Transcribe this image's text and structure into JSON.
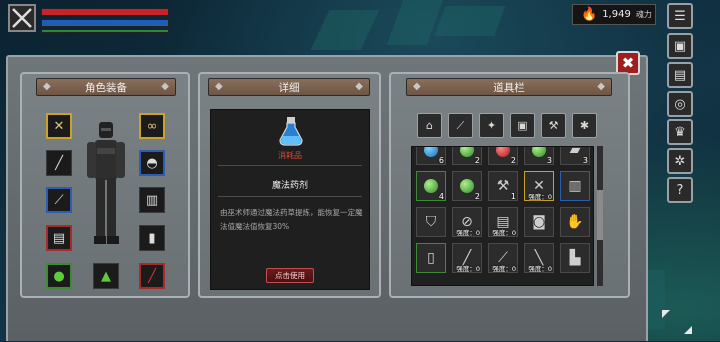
{
  "hud": {
    "soul_value": "1,949",
    "soul_unit": "魂力"
  },
  "side_menu": [
    {
      "name": "menu-button",
      "icon": "☰"
    },
    {
      "name": "equipment-button",
      "icon": "▣"
    },
    {
      "name": "inventory-bag-button",
      "icon": "▤"
    },
    {
      "name": "skills-button",
      "icon": "◎"
    },
    {
      "name": "crown-button",
      "icon": "♛"
    },
    {
      "name": "settings-button",
      "icon": "✲"
    },
    {
      "name": "help-button",
      "icon": "?"
    }
  ],
  "panels": {
    "equip_title": "角色装备",
    "detail_title": "详细",
    "inventory_title": "道具栏"
  },
  "equipment_slots": [
    {
      "name": "slot-weapon-main",
      "icon": "✕",
      "quality": "gold"
    },
    {
      "name": "slot-amulet",
      "icon": "∞",
      "quality": "gold"
    },
    {
      "name": "slot-spear",
      "icon": "╱",
      "quality": ""
    },
    {
      "name": "slot-helmet",
      "icon": "◓",
      "quality": "blue"
    },
    {
      "name": "slot-dagger",
      "icon": "⟋",
      "quality": "blue"
    },
    {
      "name": "slot-armor",
      "icon": "▥",
      "quality": ""
    },
    {
      "name": "slot-gloves",
      "icon": "▤",
      "quality": "red"
    },
    {
      "name": "slot-boots",
      "icon": "▮",
      "quality": ""
    },
    {
      "name": "slot-potion-green",
      "icon": "●",
      "quality": "green"
    },
    {
      "name": "slot-flask-green",
      "icon": "▲",
      "quality": ""
    },
    {
      "name": "slot-vial-red",
      "icon": "╱",
      "quality": "red"
    }
  ],
  "detail": {
    "item_type": "消耗品",
    "item_name": "魔法药剂",
    "item_desc": "由巫术师通过魔法药草提炼，能恢复一定魔法值魔法值恢复30%",
    "use_label": "点击使用"
  },
  "inventory_filters": [
    {
      "name": "filter-all",
      "icon": "⌂"
    },
    {
      "name": "filter-weapon",
      "icon": "⟋"
    },
    {
      "name": "filter-armor",
      "icon": "✦"
    },
    {
      "name": "filter-accessory",
      "icon": "▣"
    },
    {
      "name": "filter-tools",
      "icon": "⚒"
    },
    {
      "name": "filter-misc",
      "icon": "✱"
    }
  ],
  "inventory_items": [
    {
      "name": "item-mana-potion",
      "kind": "p-blue",
      "count": "6",
      "quality": ""
    },
    {
      "name": "item-green-flask",
      "kind": "p-green",
      "count": "2",
      "quality": ""
    },
    {
      "name": "item-red-potion",
      "kind": "p-red",
      "count": "2",
      "quality": ""
    },
    {
      "name": "item-green-potion",
      "kind": "p-green",
      "count": "3",
      "quality": ""
    },
    {
      "name": "item-iron-ingot",
      "kind": "icon",
      "icon": "▰",
      "count": "3",
      "quality": ""
    },
    {
      "name": "item-green-potion-2",
      "kind": "p-green",
      "count": "4",
      "quality": "green"
    },
    {
      "name": "item-green-potion-3",
      "kind": "p-green",
      "count": "2",
      "quality": ""
    },
    {
      "name": "item-axe",
      "kind": "icon",
      "icon": "⚒",
      "count": "1",
      "quality": ""
    },
    {
      "name": "item-crossed-swords",
      "kind": "icon",
      "icon": "✕",
      "count": "",
      "durability": "强度：0",
      "quality": "gold"
    },
    {
      "name": "item-chestplate",
      "kind": "icon",
      "icon": "▥",
      "count": "",
      "quality": "blue"
    },
    {
      "name": "item-shield",
      "kind": "icon",
      "icon": "⛉",
      "count": "",
      "quality": ""
    },
    {
      "name": "item-broken-helm",
      "kind": "icon",
      "icon": "⊘",
      "count": "",
      "durability": "强度：0",
      "quality": ""
    },
    {
      "name": "item-vest",
      "kind": "icon",
      "icon": "▤",
      "count": "",
      "durability": "强度：0",
      "quality": ""
    },
    {
      "name": "item-chestguard",
      "kind": "icon",
      "icon": "◙",
      "count": "",
      "quality": ""
    },
    {
      "name": "item-gauntlet",
      "kind": "icon",
      "icon": "✋",
      "count": "",
      "quality": ""
    },
    {
      "name": "item-bracer",
      "kind": "icon",
      "icon": "▯",
      "count": "",
      "quality": "green"
    },
    {
      "name": "item-sword",
      "kind": "icon",
      "icon": "╱",
      "count": "",
      "durability": "强度：0",
      "quality": ""
    },
    {
      "name": "item-dagger",
      "kind": "icon",
      "icon": "⟋",
      "count": "",
      "durability": "强度：0",
      "quality": ""
    },
    {
      "name": "item-spear",
      "kind": "icon",
      "icon": "╲",
      "count": "",
      "durability": "强度：0",
      "quality": ""
    },
    {
      "name": "item-boot",
      "kind": "icon",
      "icon": "▙",
      "count": "",
      "quality": ""
    }
  ]
}
